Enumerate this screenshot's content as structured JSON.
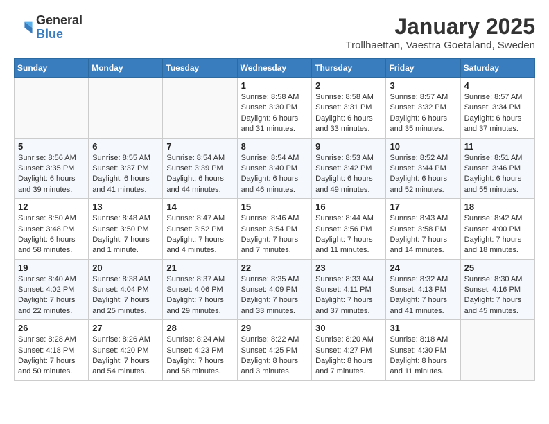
{
  "header": {
    "logo": {
      "general": "General",
      "blue": "Blue"
    },
    "title": "January 2025",
    "location": "Trollhaettan, Vaestra Goetaland, Sweden"
  },
  "weekdays": [
    "Sunday",
    "Monday",
    "Tuesday",
    "Wednesday",
    "Thursday",
    "Friday",
    "Saturday"
  ],
  "weeks": [
    [
      {
        "day": "",
        "info": ""
      },
      {
        "day": "",
        "info": ""
      },
      {
        "day": "",
        "info": ""
      },
      {
        "day": "1",
        "info": "Sunrise: 8:58 AM\nSunset: 3:30 PM\nDaylight: 6 hours\nand 31 minutes."
      },
      {
        "day": "2",
        "info": "Sunrise: 8:58 AM\nSunset: 3:31 PM\nDaylight: 6 hours\nand 33 minutes."
      },
      {
        "day": "3",
        "info": "Sunrise: 8:57 AM\nSunset: 3:32 PM\nDaylight: 6 hours\nand 35 minutes."
      },
      {
        "day": "4",
        "info": "Sunrise: 8:57 AM\nSunset: 3:34 PM\nDaylight: 6 hours\nand 37 minutes."
      }
    ],
    [
      {
        "day": "5",
        "info": "Sunrise: 8:56 AM\nSunset: 3:35 PM\nDaylight: 6 hours\nand 39 minutes."
      },
      {
        "day": "6",
        "info": "Sunrise: 8:55 AM\nSunset: 3:37 PM\nDaylight: 6 hours\nand 41 minutes."
      },
      {
        "day": "7",
        "info": "Sunrise: 8:54 AM\nSunset: 3:39 PM\nDaylight: 6 hours\nand 44 minutes."
      },
      {
        "day": "8",
        "info": "Sunrise: 8:54 AM\nSunset: 3:40 PM\nDaylight: 6 hours\nand 46 minutes."
      },
      {
        "day": "9",
        "info": "Sunrise: 8:53 AM\nSunset: 3:42 PM\nDaylight: 6 hours\nand 49 minutes."
      },
      {
        "day": "10",
        "info": "Sunrise: 8:52 AM\nSunset: 3:44 PM\nDaylight: 6 hours\nand 52 minutes."
      },
      {
        "day": "11",
        "info": "Sunrise: 8:51 AM\nSunset: 3:46 PM\nDaylight: 6 hours\nand 55 minutes."
      }
    ],
    [
      {
        "day": "12",
        "info": "Sunrise: 8:50 AM\nSunset: 3:48 PM\nDaylight: 6 hours\nand 58 minutes."
      },
      {
        "day": "13",
        "info": "Sunrise: 8:48 AM\nSunset: 3:50 PM\nDaylight: 7 hours\nand 1 minute."
      },
      {
        "day": "14",
        "info": "Sunrise: 8:47 AM\nSunset: 3:52 PM\nDaylight: 7 hours\nand 4 minutes."
      },
      {
        "day": "15",
        "info": "Sunrise: 8:46 AM\nSunset: 3:54 PM\nDaylight: 7 hours\nand 7 minutes."
      },
      {
        "day": "16",
        "info": "Sunrise: 8:44 AM\nSunset: 3:56 PM\nDaylight: 7 hours\nand 11 minutes."
      },
      {
        "day": "17",
        "info": "Sunrise: 8:43 AM\nSunset: 3:58 PM\nDaylight: 7 hours\nand 14 minutes."
      },
      {
        "day": "18",
        "info": "Sunrise: 8:42 AM\nSunset: 4:00 PM\nDaylight: 7 hours\nand 18 minutes."
      }
    ],
    [
      {
        "day": "19",
        "info": "Sunrise: 8:40 AM\nSunset: 4:02 PM\nDaylight: 7 hours\nand 22 minutes."
      },
      {
        "day": "20",
        "info": "Sunrise: 8:38 AM\nSunset: 4:04 PM\nDaylight: 7 hours\nand 25 minutes."
      },
      {
        "day": "21",
        "info": "Sunrise: 8:37 AM\nSunset: 4:06 PM\nDaylight: 7 hours\nand 29 minutes."
      },
      {
        "day": "22",
        "info": "Sunrise: 8:35 AM\nSunset: 4:09 PM\nDaylight: 7 hours\nand 33 minutes."
      },
      {
        "day": "23",
        "info": "Sunrise: 8:33 AM\nSunset: 4:11 PM\nDaylight: 7 hours\nand 37 minutes."
      },
      {
        "day": "24",
        "info": "Sunrise: 8:32 AM\nSunset: 4:13 PM\nDaylight: 7 hours\nand 41 minutes."
      },
      {
        "day": "25",
        "info": "Sunrise: 8:30 AM\nSunset: 4:16 PM\nDaylight: 7 hours\nand 45 minutes."
      }
    ],
    [
      {
        "day": "26",
        "info": "Sunrise: 8:28 AM\nSunset: 4:18 PM\nDaylight: 7 hours\nand 50 minutes."
      },
      {
        "day": "27",
        "info": "Sunrise: 8:26 AM\nSunset: 4:20 PM\nDaylight: 7 hours\nand 54 minutes."
      },
      {
        "day": "28",
        "info": "Sunrise: 8:24 AM\nSunset: 4:23 PM\nDaylight: 7 hours\nand 58 minutes."
      },
      {
        "day": "29",
        "info": "Sunrise: 8:22 AM\nSunset: 4:25 PM\nDaylight: 8 hours\nand 3 minutes."
      },
      {
        "day": "30",
        "info": "Sunrise: 8:20 AM\nSunset: 4:27 PM\nDaylight: 8 hours\nand 7 minutes."
      },
      {
        "day": "31",
        "info": "Sunrise: 8:18 AM\nSunset: 4:30 PM\nDaylight: 8 hours\nand 11 minutes."
      },
      {
        "day": "",
        "info": ""
      }
    ]
  ]
}
